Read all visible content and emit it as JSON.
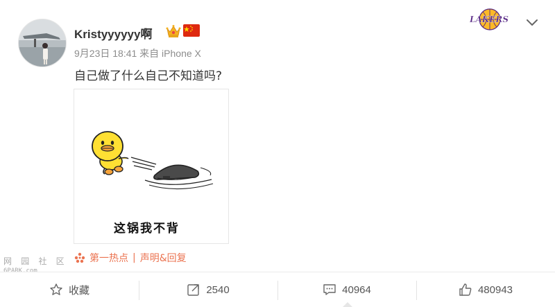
{
  "post": {
    "username": "Kristyyyyyy啊",
    "meta": "9月23日 18:41 来自 iPhone X",
    "text": "自己做了什么自己不知道吗?",
    "image_caption": "这锅我不背",
    "source_label": "第一热点",
    "source_separator": "|",
    "source_action": "声明&回复"
  },
  "actions": {
    "favorite_label": "收藏",
    "repost_count": "2540",
    "comment_count": "40964",
    "like_count": "480943"
  },
  "watermark": {
    "glyphs": "网 园 社 区",
    "domain": "6PARK.com"
  },
  "colors": {
    "source_orange": "#eb7350",
    "duck_yellow": "#ffe033",
    "lakers_purple": "#552583",
    "lakers_gold": "#fdb927"
  },
  "icons": [
    "crown-icon",
    "china-flag-icon",
    "lakers-logo",
    "chevron-down-icon",
    "hotspot-icon",
    "star-icon",
    "repost-icon",
    "comment-icon",
    "like-icon"
  ]
}
